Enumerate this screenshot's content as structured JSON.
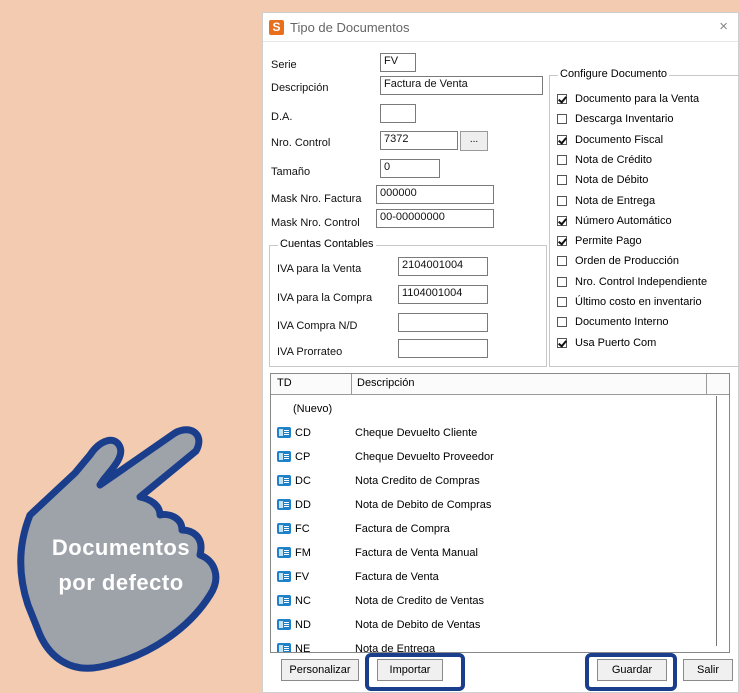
{
  "window": {
    "title": "Tipo de Documentos",
    "close_glyph": "×"
  },
  "form": {
    "serie_label": "Serie",
    "serie_value": "FV",
    "descripcion_label": "Descripción",
    "descripcion_value": "Factura de Venta",
    "da_label": "D.A.",
    "da_value": "",
    "nro_control_label": "Nro. Control",
    "nro_control_value": "7372",
    "nro_control_btn": "...",
    "tamano_label": "Tamaño",
    "tamano_value": "0",
    "mask_factura_label": "Mask Nro. Factura",
    "mask_factura_value": "000000",
    "mask_control_label": "Mask Nro. Control",
    "mask_control_value": "00-00000000"
  },
  "cuentas": {
    "title": "Cuentas Contables",
    "iva_venta_label": "IVA para la Venta",
    "iva_venta_value": "2104001004",
    "iva_compra_label": "IVA para la Compra",
    "iva_compra_value": "1104001004",
    "iva_nd_label": "IVA Compra N/D",
    "iva_nd_value": "",
    "iva_prorrateo_label": "IVA Prorrateo",
    "iva_prorrateo_value": ""
  },
  "config": {
    "title": "Configure Documento",
    "options": [
      {
        "label": "Documento para la Venta",
        "checked": true
      },
      {
        "label": "Descarga Inventario",
        "checked": false
      },
      {
        "label": "Documento Fiscal",
        "checked": true
      },
      {
        "label": "Nota de Crédito",
        "checked": false
      },
      {
        "label": "Nota de Débito",
        "checked": false
      },
      {
        "label": "Nota de Entrega",
        "checked": false
      },
      {
        "label": "Número Automático",
        "checked": true
      },
      {
        "label": "Permite Pago",
        "checked": true
      },
      {
        "label": "Orden de Producción",
        "checked": false
      },
      {
        "label": "Nro. Control Independiente",
        "checked": false
      },
      {
        "label": "Último costo en inventario",
        "checked": false
      },
      {
        "label": "Documento Interno",
        "checked": false
      },
      {
        "label": "Usa Puerto Com",
        "checked": true
      }
    ]
  },
  "table": {
    "columns": [
      "TD",
      "Descripción"
    ],
    "new_row_label": "(Nuevo)",
    "rows": [
      {
        "td": "CD",
        "desc": "Cheque Devuelto Cliente"
      },
      {
        "td": "CP",
        "desc": "Cheque Devuelto Proveedor"
      },
      {
        "td": "DC",
        "desc": "Nota Credito de Compras"
      },
      {
        "td": "DD",
        "desc": "Nota de Debito de Compras"
      },
      {
        "td": "FC",
        "desc": "Factura de Compra"
      },
      {
        "td": "FM",
        "desc": "Factura de Venta Manual"
      },
      {
        "td": "FV",
        "desc": "Factura de Venta"
      },
      {
        "td": "NC",
        "desc": "Nota de Credito de Ventas"
      },
      {
        "td": "ND",
        "desc": "Nota de Debito de Ventas"
      },
      {
        "td": "NE",
        "desc": "Nota de Entrega"
      }
    ]
  },
  "buttons": {
    "personalizar": "Personalizar",
    "importar": "Importar",
    "guardar": "Guardar",
    "salir": "Salir"
  },
  "overlay": {
    "line1": "Documentos",
    "line2": "por defecto",
    "hand_icon": "pointing-hand-icon"
  },
  "colors": {
    "background": "#f2cbb0",
    "highlight": "#1a3e8c",
    "hand": "#9ea2a9",
    "app_icon": "#e8701c"
  }
}
